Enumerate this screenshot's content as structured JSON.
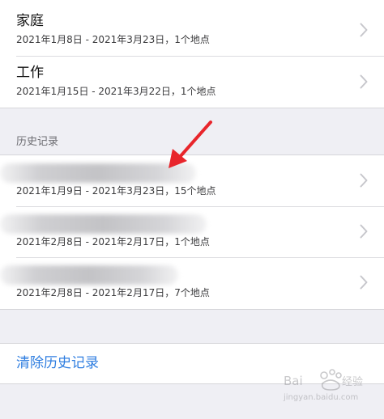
{
  "frequent_places": [
    {
      "title": "家庭",
      "detail": "2021年1月8日 - 2021年3月23日，1个地点"
    },
    {
      "title": "工作",
      "detail": "2021年1月15日 - 2021年3月22日，1个地点"
    }
  ],
  "history": {
    "header": "历史记录",
    "items": [
      {
        "detail": "2021年1月9日 - 2021年3月23日，15个地点"
      },
      {
        "detail": "2021年2月8日 - 2021年2月17日，1个地点"
      },
      {
        "detail": "2021年2月8日 - 2021年2月17日，7个地点"
      }
    ]
  },
  "clear_history": "清除历史记录",
  "annotation": {
    "arrow_color": "#e8252b"
  },
  "colors": {
    "background": "#efeff4",
    "accent": "#2f7ee0",
    "chevron": "#c7c7cc"
  },
  "icons": [
    "chevron-right-icon",
    "red-arrow-icon",
    "baidu-watermark-icon"
  ]
}
